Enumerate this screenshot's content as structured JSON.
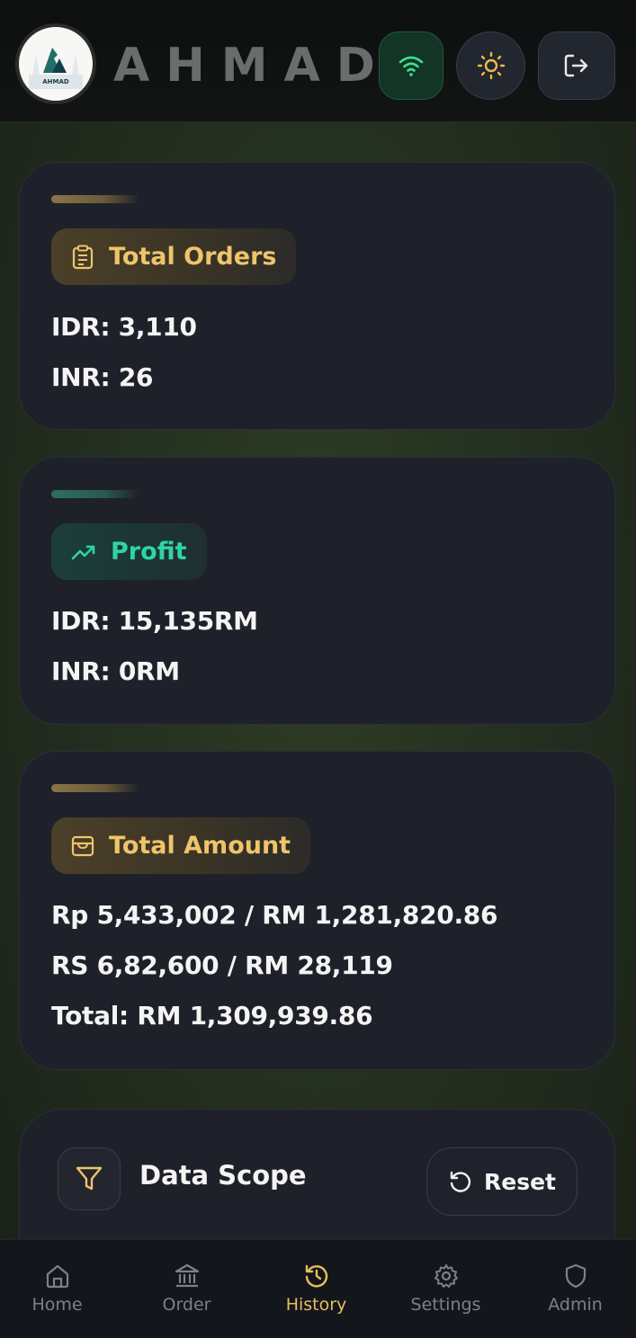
{
  "header": {
    "brand": "AHMAD",
    "logo_text": "AHMAD",
    "buttons": [
      {
        "icon": "wifi-icon",
        "color": "#3ee08f"
      },
      {
        "icon": "sun-icon",
        "color": "#f0b94a"
      },
      {
        "icon": "logout-icon",
        "color": "#e9e9e9"
      }
    ]
  },
  "cards": {
    "orders": {
      "title": "Total Orders",
      "lines": [
        "IDR: 3,110",
        "INR: 26"
      ]
    },
    "profit": {
      "title": "Profit",
      "lines": [
        "IDR: 15,135RM",
        "INR: 0RM"
      ]
    },
    "amount": {
      "title": "Total Amount",
      "lines": [
        "Rp 5,433,002 / RM 1,281,820.86",
        "RS 6,82,600 / RM 28,119",
        "Total: RM 1,309,939.86"
      ]
    }
  },
  "scope": {
    "title": "Data Scope",
    "reset_label": "Reset"
  },
  "nav": {
    "items": [
      {
        "label": "Home",
        "icon": "home-icon"
      },
      {
        "label": "Order",
        "icon": "bank-icon"
      },
      {
        "label": "History",
        "icon": "history-icon",
        "active": true
      },
      {
        "label": "Settings",
        "icon": "gear-icon"
      },
      {
        "label": "Admin",
        "icon": "shield-icon"
      }
    ]
  },
  "colors": {
    "accent_gold": "#efc46a",
    "accent_teal": "#2fd4a6",
    "nav_active": "#e8bd5e"
  }
}
